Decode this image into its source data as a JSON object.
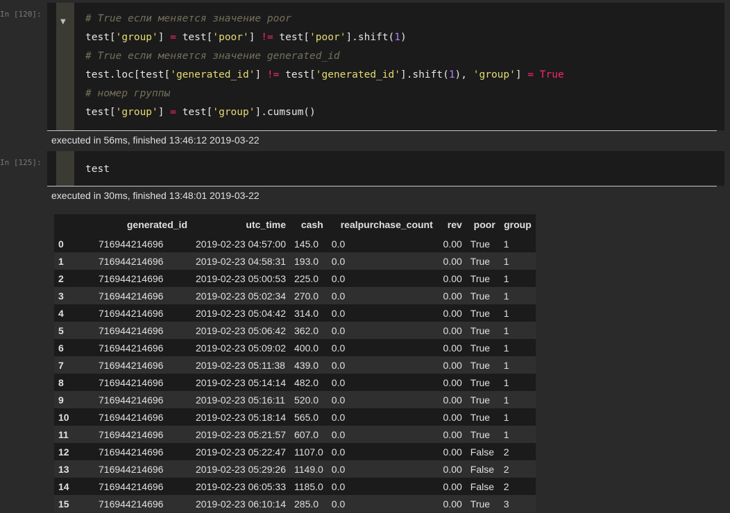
{
  "cells": [
    {
      "prompt": "In [120]:",
      "collapse_icon": "triangle-down",
      "exec_info": "executed in 56ms, finished 13:46:12 2019-03-22"
    },
    {
      "prompt": "In [125]:",
      "code": "test",
      "exec_info": "executed in 30ms, finished 13:48:01 2019-03-22"
    }
  ],
  "code_tokens": {
    "c1": "# True если меняется значение poor",
    "c2": "# True если меняется значение generated_id",
    "c3": "# номер группы",
    "test": "test",
    "test_loc": "test.loc[test[",
    "lbr": "test[",
    "rbr": "]",
    "s_group": "'group'",
    "s_poor": "'poor'",
    "s_gid": "'generated_id'",
    "eq": " = ",
    "neq": " != ",
    "shift_open": "].shift(",
    "one": "1",
    "close": ")",
    "close_comma": "), ",
    "true_kw": "True",
    "cumsum": "].cumsum()",
    "bracket_eq": "] = ",
    "bracket_space": "] "
  },
  "table": {
    "columns": [
      "",
      "generated_id",
      "utc_time",
      "cash",
      "realpurchase_count",
      "rev",
      "poor",
      "group"
    ],
    "rows": [
      [
        "0",
        "716944214696",
        "2019-02-23 04:57:00",
        "145.0",
        "0.0",
        "0.00",
        "True",
        "1"
      ],
      [
        "1",
        "716944214696",
        "2019-02-23 04:58:31",
        "193.0",
        "0.0",
        "0.00",
        "True",
        "1"
      ],
      [
        "2",
        "716944214696",
        "2019-02-23 05:00:53",
        "225.0",
        "0.0",
        "0.00",
        "True",
        "1"
      ],
      [
        "3",
        "716944214696",
        "2019-02-23 05:02:34",
        "270.0",
        "0.0",
        "0.00",
        "True",
        "1"
      ],
      [
        "4",
        "716944214696",
        "2019-02-23 05:04:42",
        "314.0",
        "0.0",
        "0.00",
        "True",
        "1"
      ],
      [
        "5",
        "716944214696",
        "2019-02-23 05:06:42",
        "362.0",
        "0.0",
        "0.00",
        "True",
        "1"
      ],
      [
        "6",
        "716944214696",
        "2019-02-23 05:09:02",
        "400.0",
        "0.0",
        "0.00",
        "True",
        "1"
      ],
      [
        "7",
        "716944214696",
        "2019-02-23 05:11:38",
        "439.0",
        "0.0",
        "0.00",
        "True",
        "1"
      ],
      [
        "8",
        "716944214696",
        "2019-02-23 05:14:14",
        "482.0",
        "0.0",
        "0.00",
        "True",
        "1"
      ],
      [
        "9",
        "716944214696",
        "2019-02-23 05:16:11",
        "520.0",
        "0.0",
        "0.00",
        "True",
        "1"
      ],
      [
        "10",
        "716944214696",
        "2019-02-23 05:18:14",
        "565.0",
        "0.0",
        "0.00",
        "True",
        "1"
      ],
      [
        "11",
        "716944214696",
        "2019-02-23 05:21:57",
        "607.0",
        "0.0",
        "0.00",
        "True",
        "1"
      ],
      [
        "12",
        "716944214696",
        "2019-02-23 05:22:47",
        "1107.0",
        "0.0",
        "0.00",
        "False",
        "2"
      ],
      [
        "13",
        "716944214696",
        "2019-02-23 05:29:26",
        "1149.0",
        "0.0",
        "0.00",
        "False",
        "2"
      ],
      [
        "14",
        "716944214696",
        "2019-02-23 06:05:33",
        "1185.0",
        "0.0",
        "0.00",
        "False",
        "2"
      ],
      [
        "15",
        "716944214696",
        "2019-02-23 06:10:14",
        "285.0",
        "0.0",
        "0.00",
        "True",
        "3"
      ]
    ]
  },
  "colors": {
    "background": "#2a2a2a",
    "code_bg": "#1b1b1b",
    "gutter": "#3b3a33",
    "comment": "#75715e",
    "string": "#e6db74",
    "keyword": "#f92672",
    "number": "#ae81ff"
  }
}
